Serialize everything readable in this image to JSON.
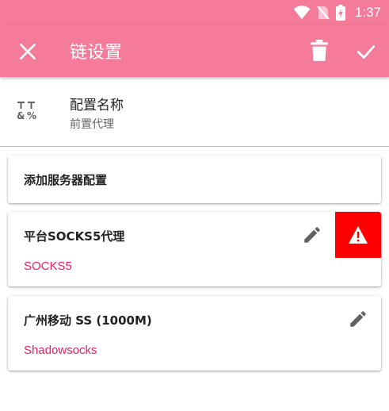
{
  "status_bar": {
    "time": "1:37"
  },
  "app_bar": {
    "title": "链设置",
    "color": "#f57b9a"
  },
  "config_name": {
    "label": "配置名称",
    "value": "前置代理"
  },
  "add_server": {
    "label": "添加服务器配置"
  },
  "servers": [
    {
      "name": "平台SOCKS5代理",
      "type": "SOCKS5",
      "warning": true,
      "icons": [
        "edit-icon",
        "warning-icon"
      ]
    },
    {
      "name": "广州移动 SS (1000M)",
      "type": "Shadowsocks",
      "warning": false,
      "icons": [
        "edit-icon"
      ]
    }
  ],
  "colors": {
    "accent": "#f57b9a",
    "type_text": "#e91e63",
    "warning_bg": "#ff0000"
  }
}
